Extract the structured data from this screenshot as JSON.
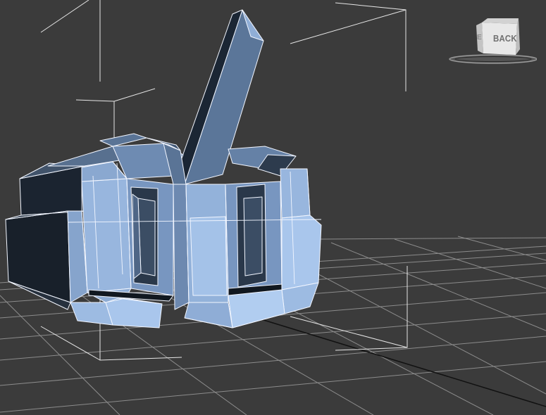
{
  "viewport": {
    "background_color": "#3b3b3b",
    "grid_color": "#8c8c8c",
    "selection_bracket_color": "#e6e6e6",
    "wireframe_edge_color": "#f2f6ff",
    "shaded_light_color": "#9dbbe2",
    "shaded_mid_color": "#5d7797",
    "shaded_dark_color": "#1b2430"
  },
  "view_cube": {
    "face_label": "BACK",
    "icon": "view-cube-icon"
  }
}
